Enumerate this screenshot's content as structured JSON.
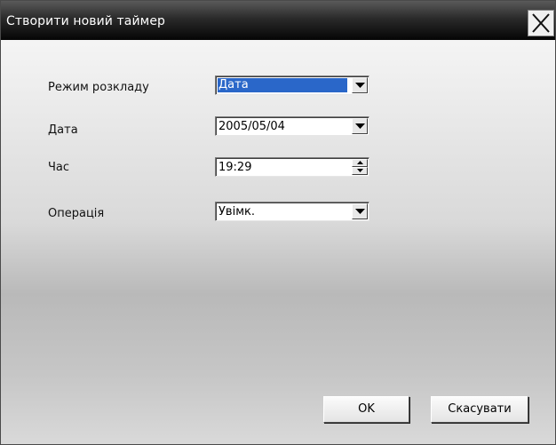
{
  "dialog": {
    "title": "Створити новий таймер"
  },
  "form": {
    "schedule_mode": {
      "label": "Режим розкладу",
      "value": "Дата"
    },
    "date": {
      "label": "Дата",
      "value": "2005/05/04"
    },
    "time": {
      "label": "Час",
      "value": "19:29"
    },
    "operation": {
      "label": "Операція",
      "value": "Увімк."
    }
  },
  "buttons": {
    "ok": "OK",
    "cancel": "Скасувати"
  },
  "colors": {
    "selection": "#2a67c9",
    "titlebar": "#050505"
  },
  "icons": {
    "close": "close-icon",
    "dropdown": "chevron-down-icon",
    "spin_up": "arrow-up-icon",
    "spin_down": "arrow-down-icon"
  }
}
